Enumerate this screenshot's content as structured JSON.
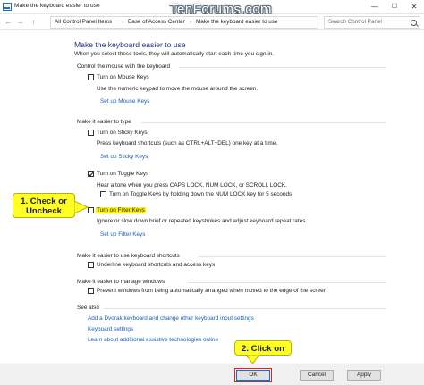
{
  "window": {
    "title": "Make the keyboard easier to use",
    "minimize_glyph": "—",
    "maximize_glyph": "☐",
    "close_glyph": "✕"
  },
  "watermark": "TenForums.com",
  "address": {
    "back_glyph": "←",
    "forward_glyph": "→",
    "up_glyph": "↑",
    "breadcrumbs": [
      "All Control Panel Items",
      "Ease of Access Center",
      "Make the keyboard easier to use"
    ],
    "separator": "›",
    "search_placeholder": "Search Control Panel"
  },
  "page": {
    "heading": "Make the keyboard easier to use",
    "intro": "When you select these tools, they will automatically start each time you sign in.",
    "sections": {
      "mouse": {
        "title": "Control the mouse with the keyboard",
        "mouse_keys_label": "Turn on Mouse Keys",
        "mouse_keys_checked": false,
        "mouse_keys_desc": "Use the numeric keypad to move the mouse around the screen.",
        "mouse_keys_link": "Set up Mouse Keys"
      },
      "typing": {
        "title": "Make it easier to type",
        "sticky_label": "Turn on Sticky Keys",
        "sticky_checked": false,
        "sticky_desc": "Press keyboard shortcuts (such as CTRL+ALT+DEL) one key at a time.",
        "sticky_link": "Set up Sticky Keys",
        "toggle_label": "Turn on Toggle Keys",
        "toggle_checked": true,
        "toggle_desc": "Hear a tone when you press CAPS LOCK, NUM LOCK, or SCROLL LOCK.",
        "toggle_hold_label": "Turn on Toggle Keys by holding down the NUM LOCK key for 5 seconds",
        "toggle_hold_checked": false,
        "filter_label": "Turn on Filter Keys",
        "filter_checked": false,
        "filter_desc": "Ignore or slow down brief or repeated keystrokes and adjust keyboard repeat rates.",
        "filter_link": "Set up Filter Keys"
      },
      "shortcuts": {
        "title": "Make it easier to use keyboard shortcuts",
        "underline_label": "Underline keyboard shortcuts and access keys",
        "underline_checked": false
      },
      "windows": {
        "title": "Make it easier to manage windows",
        "prevent_label": "Prevent windows from being automatically arranged when moved to the edge of the screen",
        "prevent_checked": false
      },
      "see_also": {
        "title": "See also",
        "links": [
          "Add a Dvorak keyboard and change other keyboard input settings",
          "Keyboard settings",
          "Learn about additional assistive technologies online"
        ]
      }
    }
  },
  "callouts": {
    "step1_line1": "1. Check or",
    "step1_line2": "Uncheck",
    "step2": "2. Click on",
    "color": "#ffff25"
  },
  "footer": {
    "ok": "OK",
    "cancel": "Cancel",
    "apply": "Apply"
  }
}
